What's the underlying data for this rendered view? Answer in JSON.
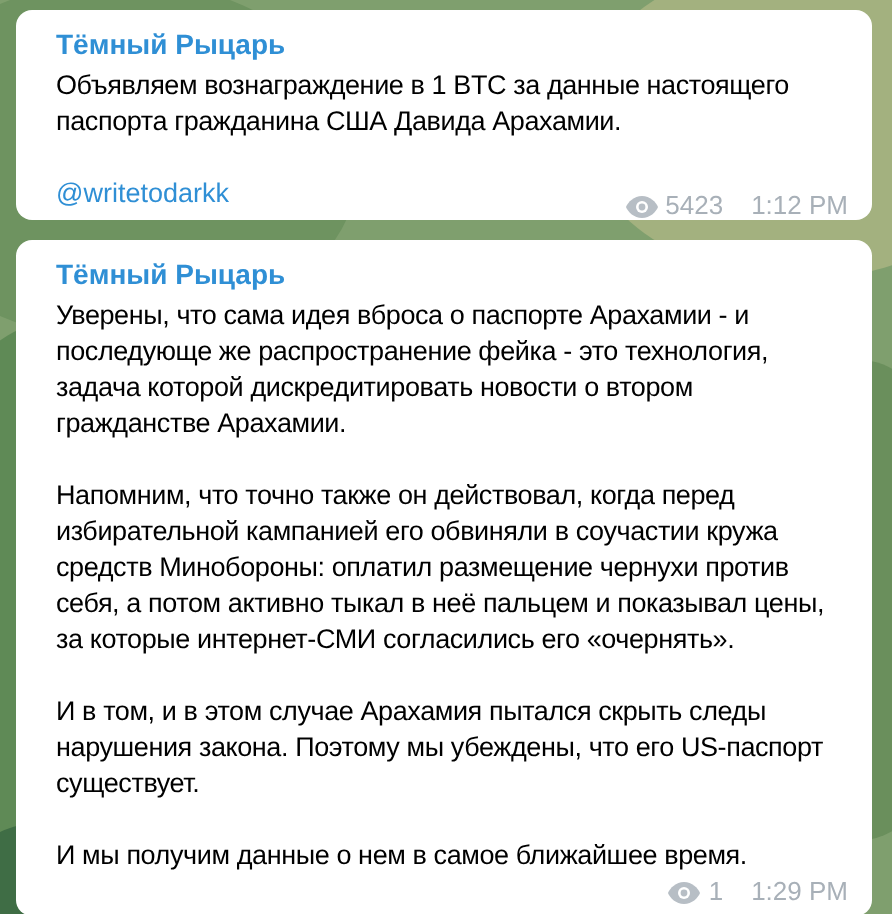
{
  "messages": [
    {
      "author": "Тёмный Рыцарь",
      "paragraphs": [
        "Объявляем вознаграждение в 1 BTC за данные настоящего паспорта гражданина США Давида Арахамии."
      ],
      "link": "@writetodarkk",
      "views": "5423",
      "time": "1:12 PM"
    },
    {
      "author": "Тёмный Рыцарь",
      "paragraphs": [
        "Уверены, что сама идея вброса о паспорте Арахамии - и последующе же распространение фейка - это технология, задача которой дискредитировать новости о втором гражданстве Арахамии.",
        "Напомним, что точно также он действовал, когда перед избирательной кампанией его обвиняли в соучастии кружа средств Минобороны: оплатил размещение чернухи против себя, а потом активно тыкал в неё пальцем и показывал цены, за которые интернет-СМИ согласились его «очернять».",
        "И в том, и в этом случае Арахамия пытался скрыть следы нарушения закона. Поэтому мы убеждены, что его US-паспорт существует.",
        "И мы получим данные о нем в самое ближайшее время."
      ],
      "views": "1",
      "time": "1:29 PM"
    }
  ]
}
